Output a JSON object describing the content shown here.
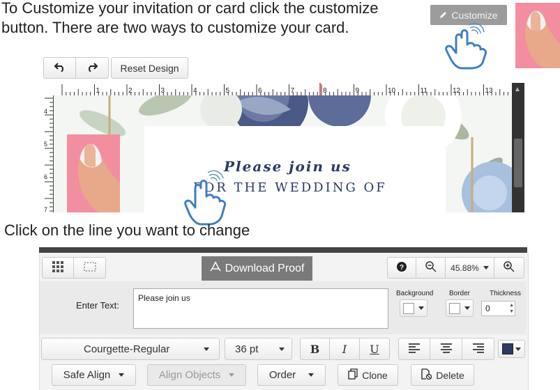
{
  "instructions": {
    "line1": "To Customize your invitation or card click the customize",
    "line2": "button.  There are two ways to customize your card.",
    "line3": "Click on the line you want to change"
  },
  "top": {
    "customize_label": "Customize"
  },
  "history_toolbar": {
    "reset_label": "Reset Design"
  },
  "ruler": {
    "labels": [
      "1",
      "2",
      "3",
      "4",
      "5",
      "6",
      "7",
      "8",
      "9",
      "10",
      "11",
      "12",
      "13",
      "14"
    ],
    "left_labels": [
      "4",
      "5",
      "6",
      "7"
    ]
  },
  "card": {
    "line1": "Please join us",
    "line2": "FOR THE WEDDING OF"
  },
  "editor": {
    "download_label": "Download Proof",
    "zoom_value": "45.88%",
    "enter_text_label": "Enter Text:",
    "text_value": "Please join us",
    "background_label": "Background",
    "border_label": "Border",
    "thickness_label": "Thickness",
    "thickness_value": "0",
    "font_name": "Courgette-Regular",
    "font_size": "36 pt",
    "bold": "B",
    "italic": "I",
    "underline": "U",
    "safe_align": "Safe Align",
    "align_objects": "Align Objects",
    "order": "Order",
    "clone": "Clone",
    "delete": "Delete",
    "text_color": "#2b3a67"
  }
}
